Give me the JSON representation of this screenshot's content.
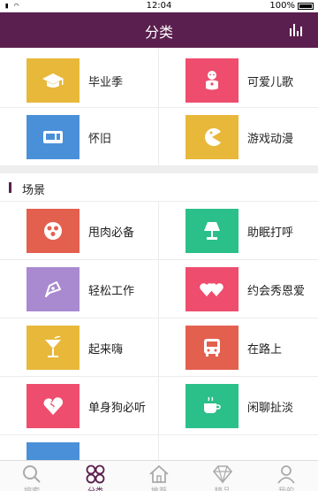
{
  "status_bar": {
    "time": "12:04",
    "battery": "100%"
  },
  "header": {
    "title": "分类"
  },
  "colors": {
    "brand": "#5a1f4e",
    "yellow": "#e8b83a",
    "pink": "#ee4d6e",
    "blue": "#4a90d9",
    "red": "#e3604f",
    "purple": "#a98ad0",
    "green": "#2bbf8a"
  },
  "top_categories": [
    {
      "label": "毕业季",
      "icon": "graduation-cap-icon",
      "color": "#e8b83a"
    },
    {
      "label": "可爱儿歌",
      "icon": "baby-icon",
      "color": "#ee4d6e"
    },
    {
      "label": "怀旧",
      "icon": "cassette-icon",
      "color": "#4a90d9"
    },
    {
      "label": "游戏动漫",
      "icon": "pacman-icon",
      "color": "#e8b83a"
    }
  ],
  "scene_section": {
    "title": "场景",
    "items": [
      {
        "label": "甩肉必备",
        "icon": "ball-icon",
        "color": "#e3604f"
      },
      {
        "label": "助眠打呼",
        "icon": "lamp-icon",
        "color": "#2bbf8a"
      },
      {
        "label": "轻松工作",
        "icon": "pen-nib-icon",
        "color": "#a98ad0"
      },
      {
        "label": "约会秀恩爱",
        "icon": "hearts-icon",
        "color": "#ee4d6e"
      },
      {
        "label": "起来嗨",
        "icon": "cocktail-icon",
        "color": "#e8b83a"
      },
      {
        "label": "在路上",
        "icon": "bus-icon",
        "color": "#e3604f"
      },
      {
        "label": "单身狗必听",
        "icon": "broken-heart-icon",
        "color": "#ee4d6e"
      },
      {
        "label": "闲聊扯淡",
        "icon": "coffee-cup-icon",
        "color": "#2bbf8a"
      }
    ]
  },
  "tabs": [
    {
      "label": "搜索",
      "icon": "search-icon",
      "active": false
    },
    {
      "label": "分类",
      "icon": "category-icon",
      "active": true
    },
    {
      "label": "推荐",
      "icon": "home-icon",
      "active": false
    },
    {
      "label": "精品",
      "icon": "diamond-icon",
      "active": false
    },
    {
      "label": "我的",
      "icon": "user-icon",
      "active": false
    }
  ]
}
